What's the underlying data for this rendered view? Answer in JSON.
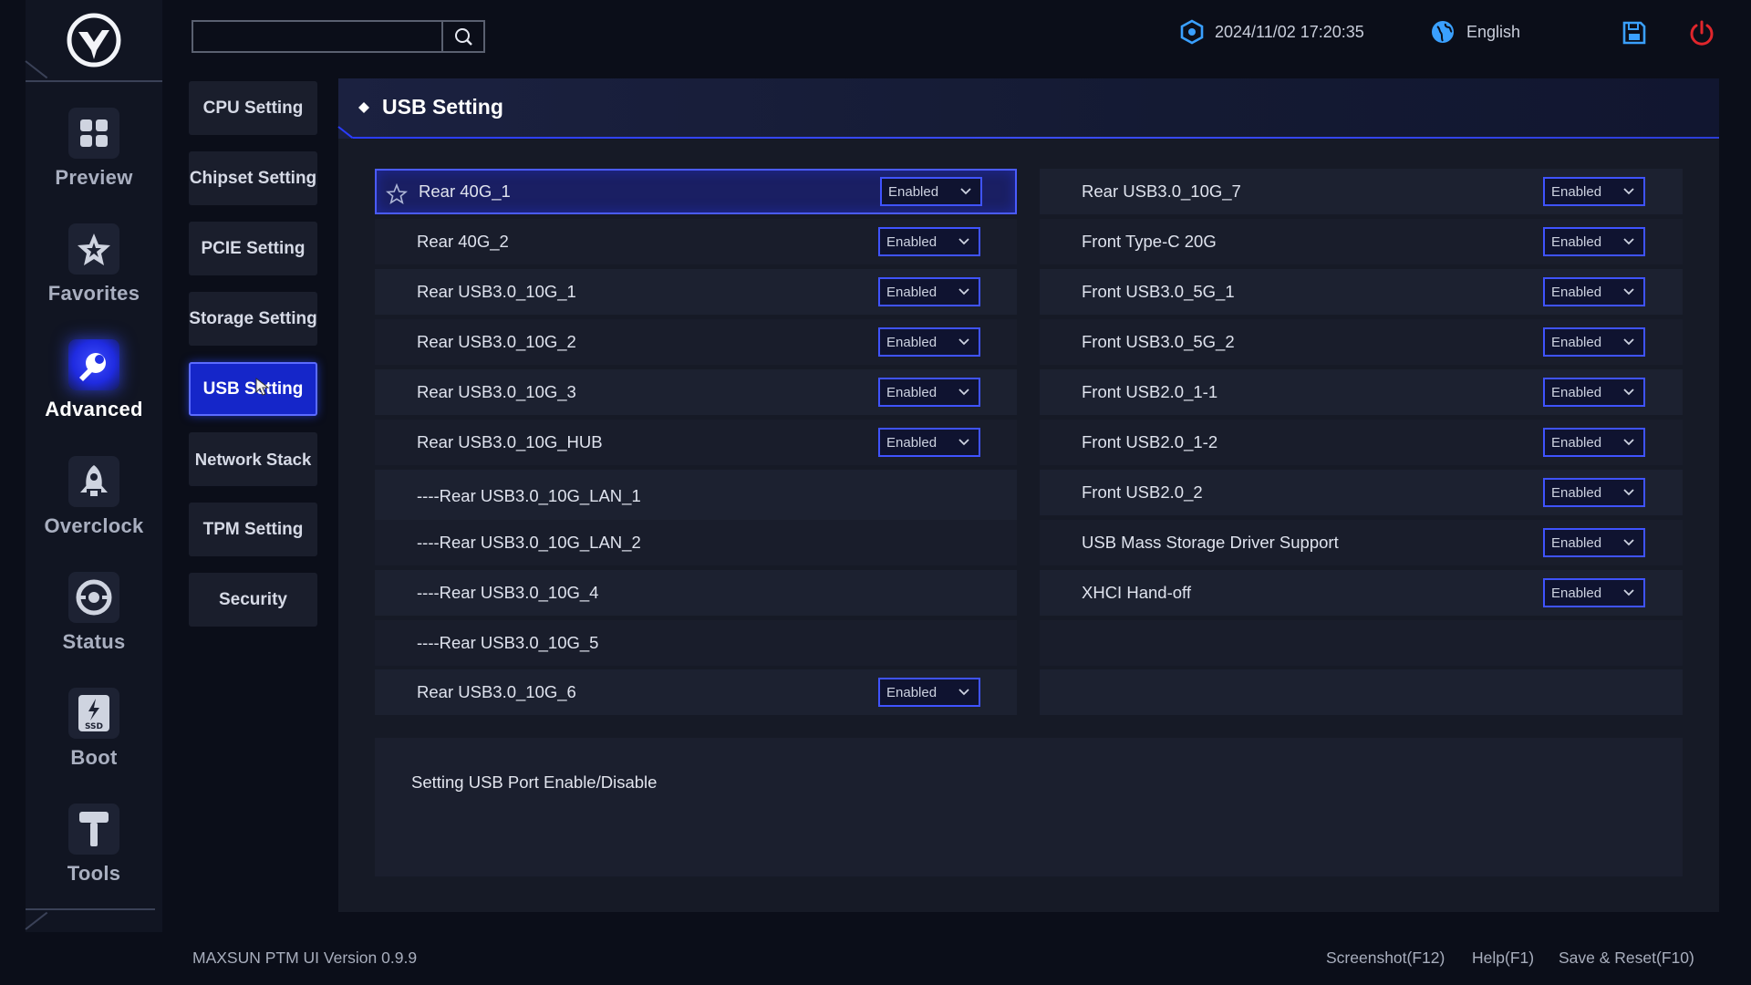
{
  "colors": {
    "accent": "#3f53ff",
    "active_bg": "#1526c9",
    "power": "#e0262c",
    "info_icon": "#3aa0ff"
  },
  "nav": {
    "items": [
      {
        "label": "Preview",
        "icon": "grid-icon"
      },
      {
        "label": "Favorites",
        "icon": "star-icon"
      },
      {
        "label": "Advanced",
        "icon": "wrench-icon",
        "active": true
      },
      {
        "label": "Overclock",
        "icon": "rocket-icon"
      },
      {
        "label": "Status",
        "icon": "gauge-icon"
      },
      {
        "label": "Boot",
        "icon": "ssd-icon"
      },
      {
        "label": "Tools",
        "icon": "hammer-icon"
      }
    ]
  },
  "submenu": {
    "items": [
      {
        "label": "CPU Setting"
      },
      {
        "label": "Chipset Setting"
      },
      {
        "label": "PCIE Setting"
      },
      {
        "label": "Storage Setting"
      },
      {
        "label": "USB Setting",
        "active": true
      },
      {
        "label": "Network Stack"
      },
      {
        "label": "TPM Setting"
      },
      {
        "label": "Security"
      }
    ]
  },
  "topbar": {
    "search_placeholder": "",
    "datetime": "2024/11/02 17:20:35",
    "language": "English"
  },
  "panel": {
    "title": "USB Setting",
    "left_rows": [
      {
        "label": "Rear 40G_1",
        "value": "Enabled"
      },
      {
        "label": "Rear 40G_2",
        "value": "Enabled"
      },
      {
        "label": "Rear USB3.0_10G_1",
        "value": "Enabled"
      },
      {
        "label": "Rear USB3.0_10G_2",
        "value": "Enabled"
      },
      {
        "label": "Rear USB3.0_10G_3",
        "value": "Enabled"
      },
      {
        "label": "Rear USB3.0_10G_HUB",
        "value": "Enabled"
      },
      {
        "label": "----Rear USB3.0_10G_LAN_1"
      },
      {
        "label": "----Rear USB3.0_10G_LAN_2"
      },
      {
        "label": "----Rear USB3.0_10G_4"
      },
      {
        "label": "----Rear USB3.0_10G_5"
      },
      {
        "label": "Rear USB3.0_10G_6",
        "value": "Enabled"
      }
    ],
    "right_rows": [
      {
        "label": "Rear USB3.0_10G_7",
        "value": "Enabled"
      },
      {
        "label": "Front Type-C 20G",
        "value": "Enabled"
      },
      {
        "label": "Front USB3.0_5G_1",
        "value": "Enabled"
      },
      {
        "label": "Front USB3.0_5G_2",
        "value": "Enabled"
      },
      {
        "label": "Front USB2.0_1-1",
        "value": "Enabled"
      },
      {
        "label": "Front USB2.0_1-2",
        "value": "Enabled"
      },
      {
        "label": "Front USB2.0_2",
        "value": "Enabled"
      },
      {
        "label": "USB Mass Storage Driver Support",
        "value": "Enabled"
      },
      {
        "label": "XHCI Hand-off",
        "value": "Enabled"
      }
    ],
    "description": "Setting USB Port Enable/Disable"
  },
  "footer": {
    "version": "MAXSUN PTM UI Version 0.9.9",
    "screenshot": "Screenshot(F12)",
    "help": "Help(F1)",
    "save_reset": "Save & Reset(F10)"
  }
}
